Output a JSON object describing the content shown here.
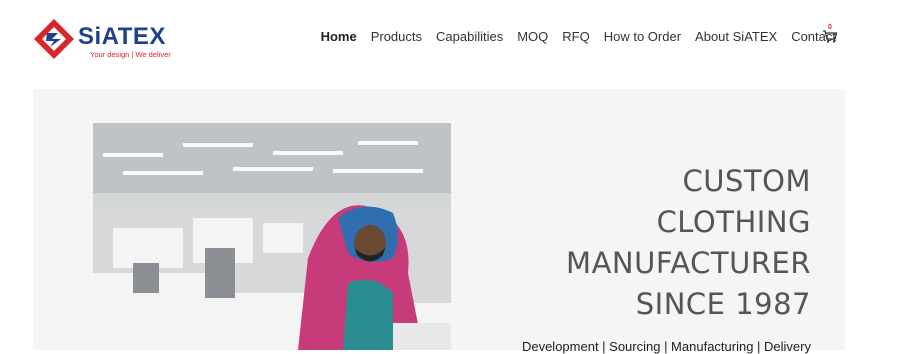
{
  "brand": {
    "name": "SiATEX",
    "tagline": "Your design | We deliver",
    "colors": {
      "primary": "#1f3f8f",
      "accent": "#d9262c"
    }
  },
  "nav": {
    "items": [
      {
        "label": "Home",
        "active": true
      },
      {
        "label": "Products",
        "active": false
      },
      {
        "label": "Capabilities",
        "active": false
      },
      {
        "label": "MOQ",
        "active": false
      },
      {
        "label": "RFQ",
        "active": false
      },
      {
        "label": "How to Order",
        "active": false
      },
      {
        "label": "About SiATEX",
        "active": false
      },
      {
        "label": "Contact",
        "active": false
      }
    ],
    "cart": {
      "icon": "cart-icon",
      "count": "0"
    }
  },
  "hero": {
    "headline_lines": [
      "CUSTOM",
      "CLOTHING",
      "MANUFACTURER",
      "SINCE 1987"
    ],
    "subline": "Development | Sourcing | Manufacturing | Delivery",
    "image_alt": "garment factory worker at sewing machine"
  }
}
